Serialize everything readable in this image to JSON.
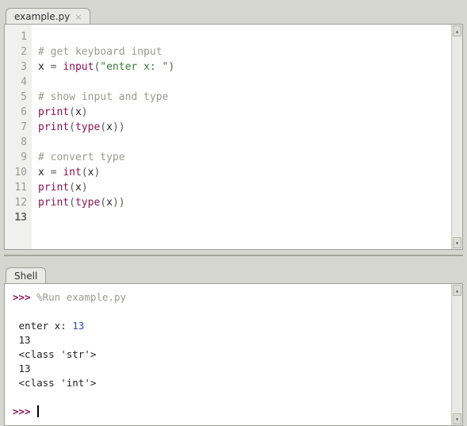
{
  "editor": {
    "tab_label": "example.py",
    "line_numbers": [
      "1",
      "2",
      "3",
      "4",
      "5",
      "6",
      "7",
      "8",
      "9",
      "10",
      "11",
      "12",
      "13"
    ],
    "current_line": 13,
    "lines": {
      "l2_comment": "# get keyboard input",
      "l3_x": "x",
      "l3_eq": " = ",
      "l3_input": "input",
      "l3_lp": "(",
      "l3_str": "\"enter x: \"",
      "l3_rp": ")",
      "l5_comment": "# show input and type",
      "l6_print": "print",
      "l6_lp": "(",
      "l6_x": "x",
      "l6_rp": ")",
      "l7_print": "print",
      "l7_lp": "(",
      "l7_type": "type",
      "l7_lp2": "(",
      "l7_x": "x",
      "l7_rp2": ")",
      "l7_rp": ")",
      "l9_comment": "# convert type",
      "l10_x": "x",
      "l10_eq": " = ",
      "l10_int": "int",
      "l10_lp": "(",
      "l10_x2": "x",
      "l10_rp": ")",
      "l11_print": "print",
      "l11_lp": "(",
      "l11_x": "x",
      "l11_rp": ")",
      "l12_print": "print",
      "l12_lp": "(",
      "l12_type": "type",
      "l12_lp2": "(",
      "l12_x": "x",
      "l12_rp2": ")",
      "l12_rp": ")"
    }
  },
  "shell": {
    "tab_label": "Shell",
    "prompt": ">>>",
    "run_cmd": "%Run example.py",
    "out_prompt_text": "enter x: ",
    "out_input_val": "13",
    "out_line1": "13",
    "out_line2": "<class 'str'>",
    "out_line3": "13",
    "out_line4": "<class 'int'>"
  }
}
